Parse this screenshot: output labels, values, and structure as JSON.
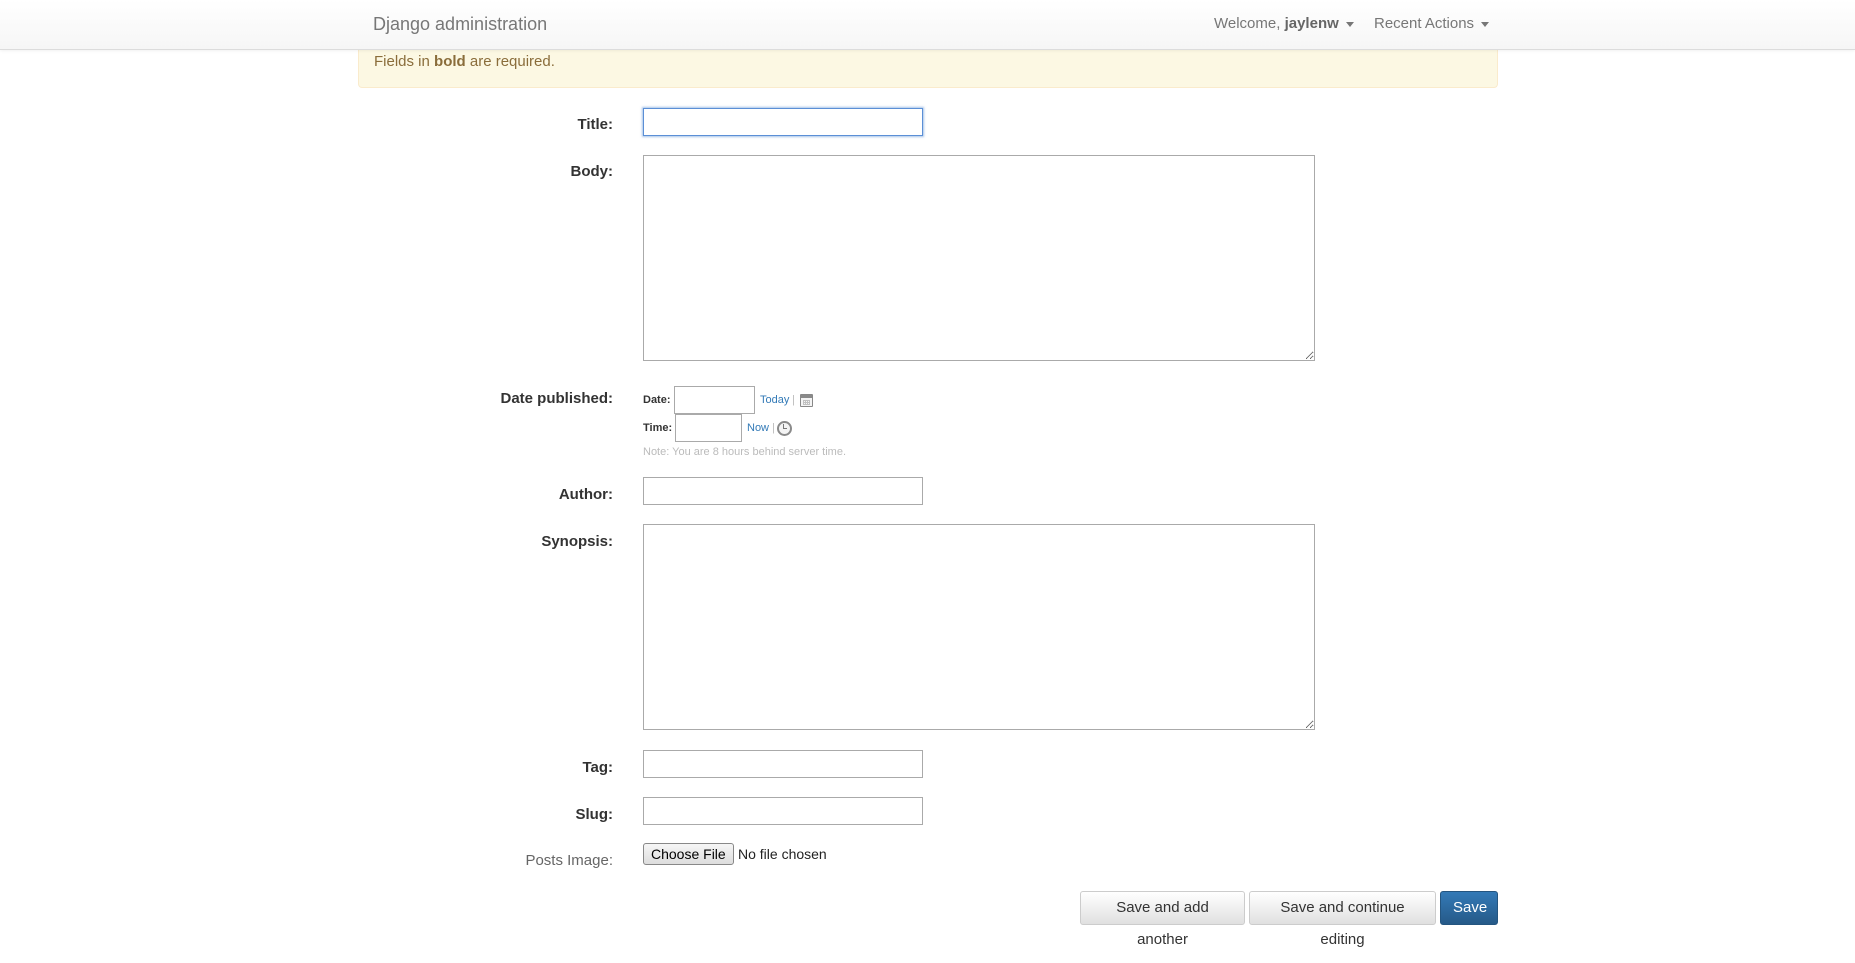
{
  "navbar": {
    "brand": "Django administration",
    "welcome_prefix": "Welcome, ",
    "username": "jaylenw",
    "recent_actions": "Recent Actions"
  },
  "alert": {
    "prefix": "Fields in ",
    "bold_word": "bold",
    "suffix": " are required."
  },
  "form": {
    "title": {
      "label": "Title:",
      "value": ""
    },
    "body": {
      "label": "Body:",
      "value": ""
    },
    "date_published": {
      "label": "Date published:",
      "date_label": "Date:",
      "date_value": "",
      "today_link": "Today",
      "time_label": "Time:",
      "time_value": "",
      "now_link": "Now",
      "separator": "|",
      "calendar_icon": "calendar-icon",
      "clock_icon": "clock-icon",
      "note": "Note: You are 8 hours behind server time."
    },
    "author": {
      "label": "Author:",
      "value": ""
    },
    "synopsis": {
      "label": "Synopsis:",
      "value": ""
    },
    "tag": {
      "label": "Tag:",
      "value": ""
    },
    "slug": {
      "label": "Slug:",
      "value": ""
    },
    "posts_image": {
      "label": "Posts Image:",
      "button": "Choose File",
      "status": "No file chosen"
    }
  },
  "submit": {
    "save_add_another": "Save and add another",
    "save_continue": "Save and continue editing",
    "save": "Save"
  },
  "colors": {
    "primary": "#337ab7",
    "alert_bg": "#fcf8e3",
    "alert_text": "#8a6d3b",
    "link": "#337ab7"
  }
}
